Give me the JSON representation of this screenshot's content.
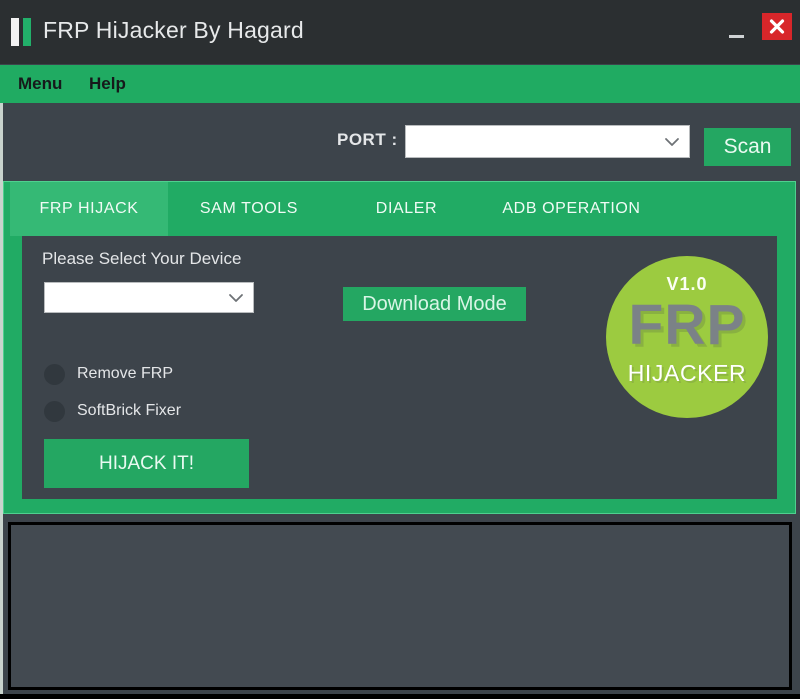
{
  "window": {
    "title": "FRP HiJacker By Hagard",
    "icon": "app-bars-icon",
    "minimize_label": "—",
    "close_label": "✕",
    "close_color": "#d8262a"
  },
  "menu_bar": {
    "items": [
      {
        "label": "Menu"
      },
      {
        "label": "Help"
      }
    ]
  },
  "port_row": {
    "label": "PORT :",
    "combo_value": "",
    "combo_placeholder": "",
    "scan_label": "Scan"
  },
  "tabs": {
    "active_index": 0,
    "items": [
      {
        "label": "FRP HIJACK"
      },
      {
        "label": "SAM TOOLS"
      },
      {
        "label": "DIALER"
      },
      {
        "label": "ADB OPERATION"
      }
    ]
  },
  "frp_panel": {
    "device_label": "Please Select Your Device",
    "device_combo_value": "",
    "device_combo_placeholder": "",
    "download_mode_label": "Download Mode",
    "options": [
      {
        "label": "Remove FRP",
        "selected": false
      },
      {
        "label": "SoftBrick Fixer",
        "selected": false
      }
    ],
    "hijack_label": "HIJACK IT!"
  },
  "logo": {
    "version": "V1.0",
    "title": "FRP",
    "subtitle": "HIJACKER",
    "circle_color": "#9ccb40"
  },
  "log_panel": {
    "text": ""
  },
  "theme": {
    "accent_green": "#21ab64",
    "button_green": "#24a762",
    "panel_gray": "#3d444b",
    "titlebar_gray": "#2b2f31"
  }
}
